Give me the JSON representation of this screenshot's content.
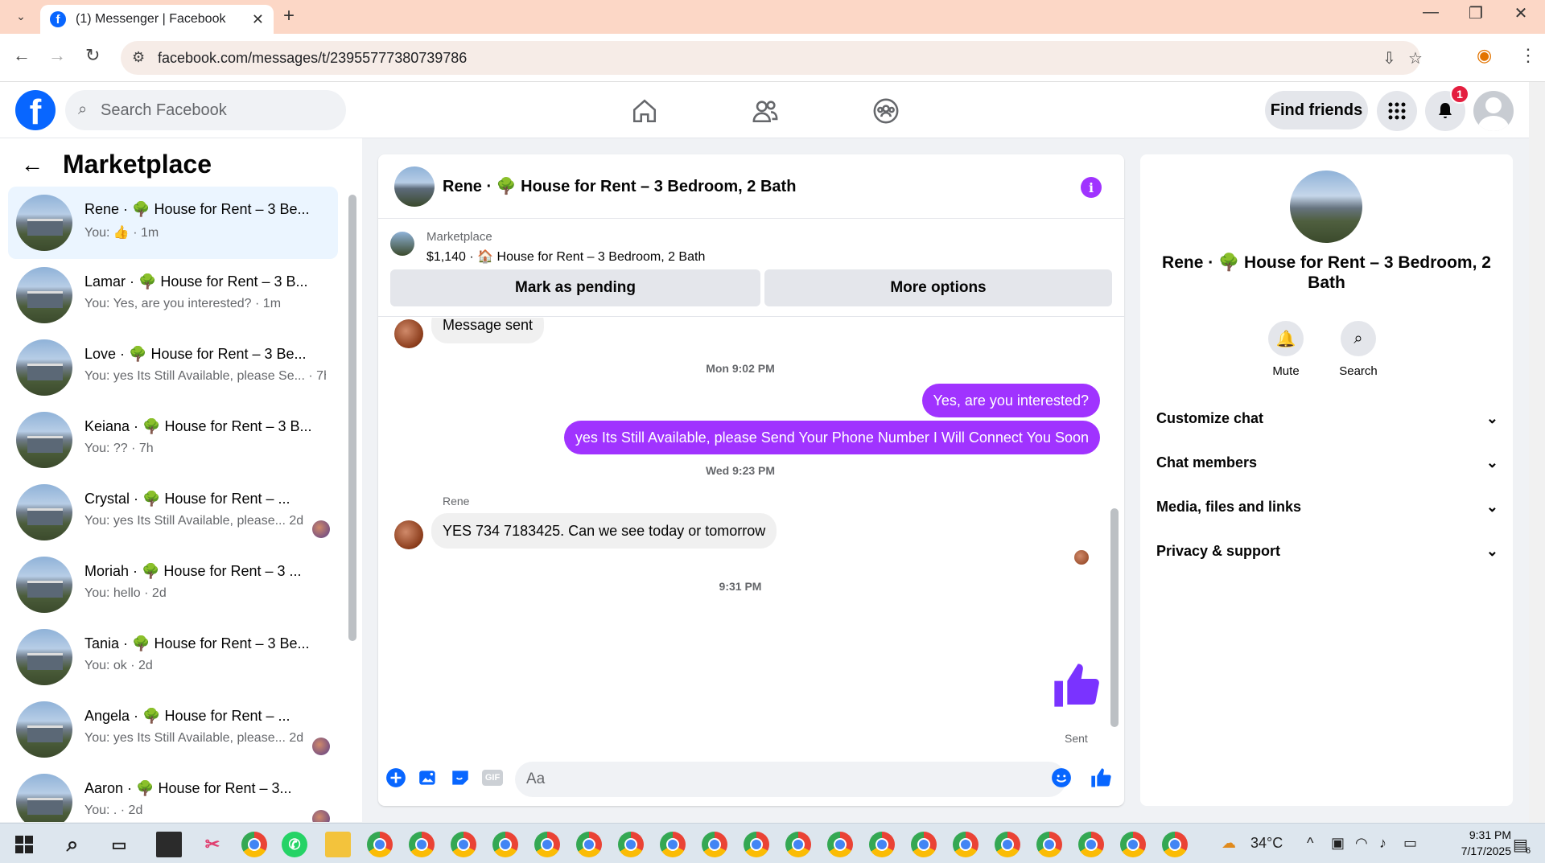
{
  "browser": {
    "tab_title": "(1) Messenger | Facebook",
    "url": "facebook.com/messages/t/23955777380739786"
  },
  "header": {
    "search_placeholder": "Search Facebook",
    "find_friends": "Find friends",
    "notification_count": "1"
  },
  "sidebar": {
    "title": "Marketplace",
    "conversations": [
      {
        "name": "Rene · 🌳 House for Rent – 3 Be...",
        "sub": "You: 👍 · 1m",
        "active": true
      },
      {
        "name": "Lamar · 🌳 House for Rent – 3 B...",
        "sub": "You: Yes, are you interested? · 1m"
      },
      {
        "name": "Love · 🌳 House for Rent – 3 Be...",
        "sub": "You: yes Its Still Available, please Se... · 7h"
      },
      {
        "name": "Keiana · 🌳 House for Rent – 3 B...",
        "sub": "You: ?? · 7h"
      },
      {
        "name": "Crystal · 🌳 House for Rent – ...",
        "sub": "You: yes Its Still Available, please...  2d"
      },
      {
        "name": "Moriah · 🌳 House for Rent – 3 ...",
        "sub": "You: hello · 2d"
      },
      {
        "name": "Tania · 🌳 House for Rent – 3 Be...",
        "sub": "You: ok · 2d"
      },
      {
        "name": "Angela · 🌳 House for Rent – ...",
        "sub": "You: yes Its Still Available, please...  2d"
      },
      {
        "name": "Aaron · 🌳 House for Rent – 3...",
        "sub": "You: . · 2d"
      }
    ]
  },
  "chat": {
    "title": "Rene · 🌳 House for Rent – 3 Bedroom, 2 Bath",
    "marketplace_label": "Marketplace",
    "listing": "$1,140 · 🏠 House for Rent – 3 Bedroom, 2 Bath",
    "mark_pending": "Mark as pending",
    "more_options": "More options",
    "messages": {
      "msg_sent": "Message sent",
      "time1": "Mon 9:02 PM",
      "out1": "Yes, are you interested?",
      "out2": "yes Its Still Available, please Send Your Phone Number I Will Connect You Soon",
      "time2": "Wed 9:23 PM",
      "sender": "Rene",
      "in1": "YES  734 7183425.  Can we see today or tomorrow",
      "time3": "9:31 PM",
      "sent_label": "Sent"
    },
    "composer_placeholder": "Aa"
  },
  "details": {
    "name": "Rene · 🌳 House for Rent – 3 Bedroom, 2 Bath",
    "mute": "Mute",
    "search": "Search",
    "sections": [
      "Customize chat",
      "Chat members",
      "Media, files and links",
      "Privacy & support"
    ]
  },
  "taskbar": {
    "weather": "34°C",
    "time": "9:31 PM",
    "date": "7/17/2025",
    "notif": "6"
  },
  "colors": {
    "accent": "#a033ff",
    "fb_blue": "#0866ff",
    "tab_bar": "#fcd7c6"
  }
}
